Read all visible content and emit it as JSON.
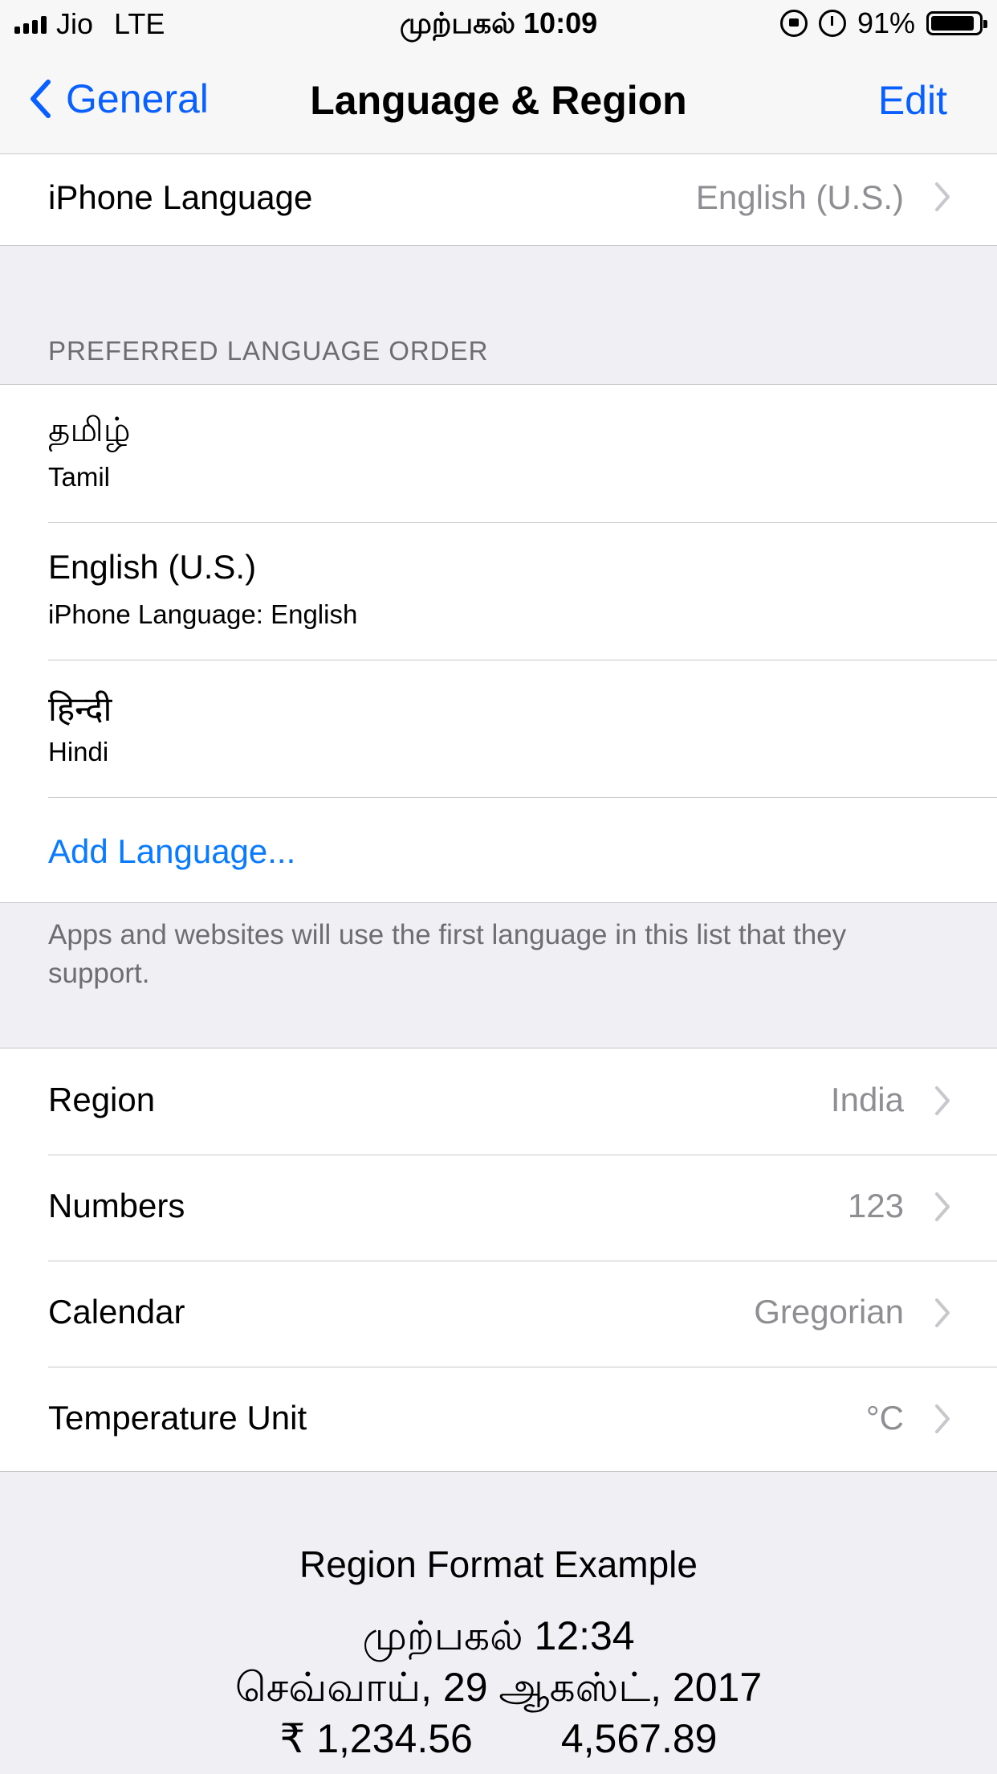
{
  "status_bar": {
    "carrier": "Jio",
    "network": "LTE",
    "time": "முற்பகல் 10:09",
    "battery": "91%",
    "battery_level": 0.91
  },
  "nav": {
    "back_label": "General",
    "title": "Language & Region",
    "edit_label": "Edit"
  },
  "iphone_language": {
    "label": "iPhone Language",
    "value": "English (U.S.)"
  },
  "preferred": {
    "header": "PREFERRED LANGUAGE ORDER",
    "languages": [
      {
        "title": "தமிழ்",
        "subtitle": "Tamil"
      },
      {
        "title": "English (U.S.)",
        "subtitle": "iPhone Language: English"
      },
      {
        "title": "हिन्दी",
        "subtitle": "Hindi"
      }
    ],
    "add_label": "Add Language...",
    "footer": "Apps and websites will use the first language in this list that they support."
  },
  "region_settings": [
    {
      "label": "Region",
      "value": "India"
    },
    {
      "label": "Numbers",
      "value": "123"
    },
    {
      "label": "Calendar",
      "value": "Gregorian"
    },
    {
      "label": "Temperature Unit",
      "value": "°C"
    }
  ],
  "format_example": {
    "title": "Region Format Example",
    "time": "முற்பகல் 12:34",
    "date": "செவ்வாய், 29 ஆகஸ்ட், 2017",
    "currency": "₹ 1,234.56",
    "number": "4,567.89"
  },
  "colors": {
    "accent": "#0a60ff",
    "link": "#0a7aff",
    "secondary_text": "#8e8e93",
    "background": "#efeff4"
  }
}
